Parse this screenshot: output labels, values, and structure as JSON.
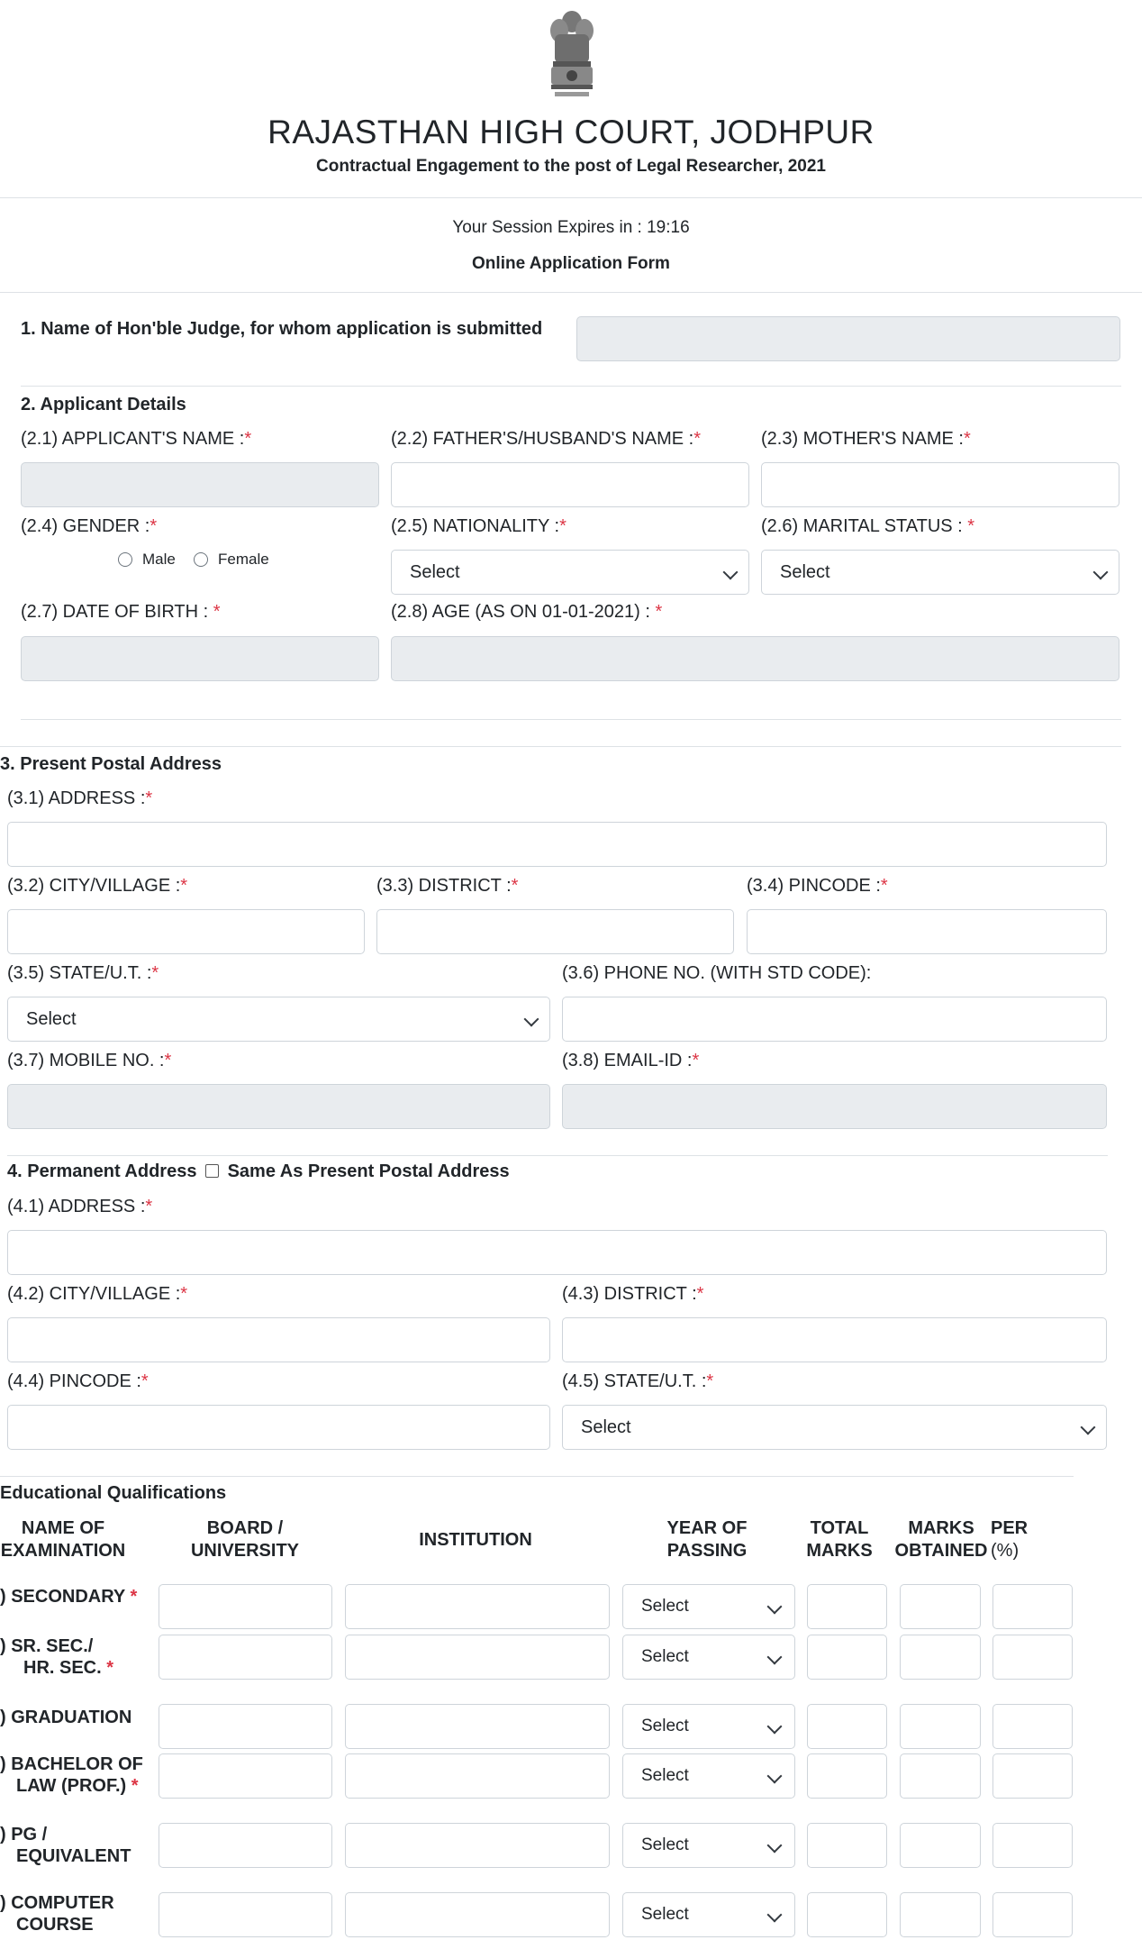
{
  "header": {
    "emblem_name": "state-emblem-icon",
    "title": "RAJASTHAN HIGH COURT, JODHPUR",
    "subtitle": "Contractual Engagement to the post of Legal Researcher, 2021",
    "session_text": "Your Session Expires in : 19:16",
    "form_title": "Online Application Form"
  },
  "section1": {
    "label": "1. Name of Hon'ble Judge, for whom application is submitted",
    "value": ""
  },
  "section2": {
    "title": "2. Applicant Details",
    "applicant_name_label": "(2.1) APPLICANT'S NAME :",
    "father_name_label": "(2.2) FATHER'S/HUSBAND'S NAME :",
    "mother_name_label": "(2.3) MOTHER'S NAME :",
    "gender_label": "(2.4) GENDER :",
    "gender_male": "Male",
    "gender_female": "Female",
    "nationality_label": "(2.5) NATIONALITY :",
    "nationality_value": "Select",
    "marital_label": "(2.6) MARITAL STATUS : ",
    "marital_value": "Select",
    "dob_label": "(2.7) DATE OF BIRTH : ",
    "age_label": "(2.8) AGE (AS ON 01-01-2021) : "
  },
  "section3": {
    "title": "3. Present Postal Address",
    "address_label": "(3.1) ADDRESS :",
    "city_label": "(3.2) CITY/VILLAGE :",
    "district_label": "(3.3) DISTRICT :",
    "pincode_label": "(3.4) PINCODE :",
    "state_label": "(3.5) STATE/U.T. :",
    "state_value": "Select",
    "phone_label": "(3.6) PHONE NO. (WITH STD CODE):",
    "mobile_label": "(3.7) MOBILE NO. :",
    "email_label": "(3.8) EMAIL-ID :"
  },
  "section4": {
    "title": "4. Permanent Address",
    "same_as_label": "Same As Present Postal Address",
    "address_label": "(4.1) ADDRESS :",
    "city_label": "(4.2) CITY/VILLAGE :",
    "district_label": "(4.3) DISTRICT :",
    "pincode_label": "(4.4) PINCODE :",
    "state_label": "(4.5) STATE/U.T. :",
    "state_value": "Select"
  },
  "required_mark": "*",
  "education": {
    "title": "Educational Qualifications",
    "columns": {
      "exam_1": "NAME OF",
      "exam_2": "EXAMINATION",
      "board_1": "BOARD /",
      "board_2": "UNIVERSITY",
      "institution": "INSTITUTION",
      "year_1": "YEAR OF",
      "year_2": "PASSING",
      "total_1": "TOTAL",
      "total_2": "MARKS",
      "marks_1": "MARKS",
      "marks_2": "OBTAINED",
      "per_1": "PER",
      "per_2": "(%)"
    },
    "rows": [
      {
        "line1": ") SECONDARY",
        "line2": "",
        "required": "*",
        "year_value": "Select"
      },
      {
        "line1": ") SR. SEC./",
        "line2": "HR. SEC.",
        "required": "*",
        "year_value": "Select"
      },
      {
        "line1": ") GRADUATION",
        "line2": "",
        "required": "",
        "year_value": "Select"
      },
      {
        "line1": ") BACHELOR OF",
        "line2": "LAW (PROF.)",
        "required": "*",
        "year_value": "Select"
      },
      {
        "line1": ") PG /",
        "line2": "EQUIVALENT",
        "required": "",
        "year_value": "Select"
      },
      {
        "line1": ") COMPUTER",
        "line2": "COURSE",
        "required": "",
        "year_value": "Select"
      }
    ]
  }
}
